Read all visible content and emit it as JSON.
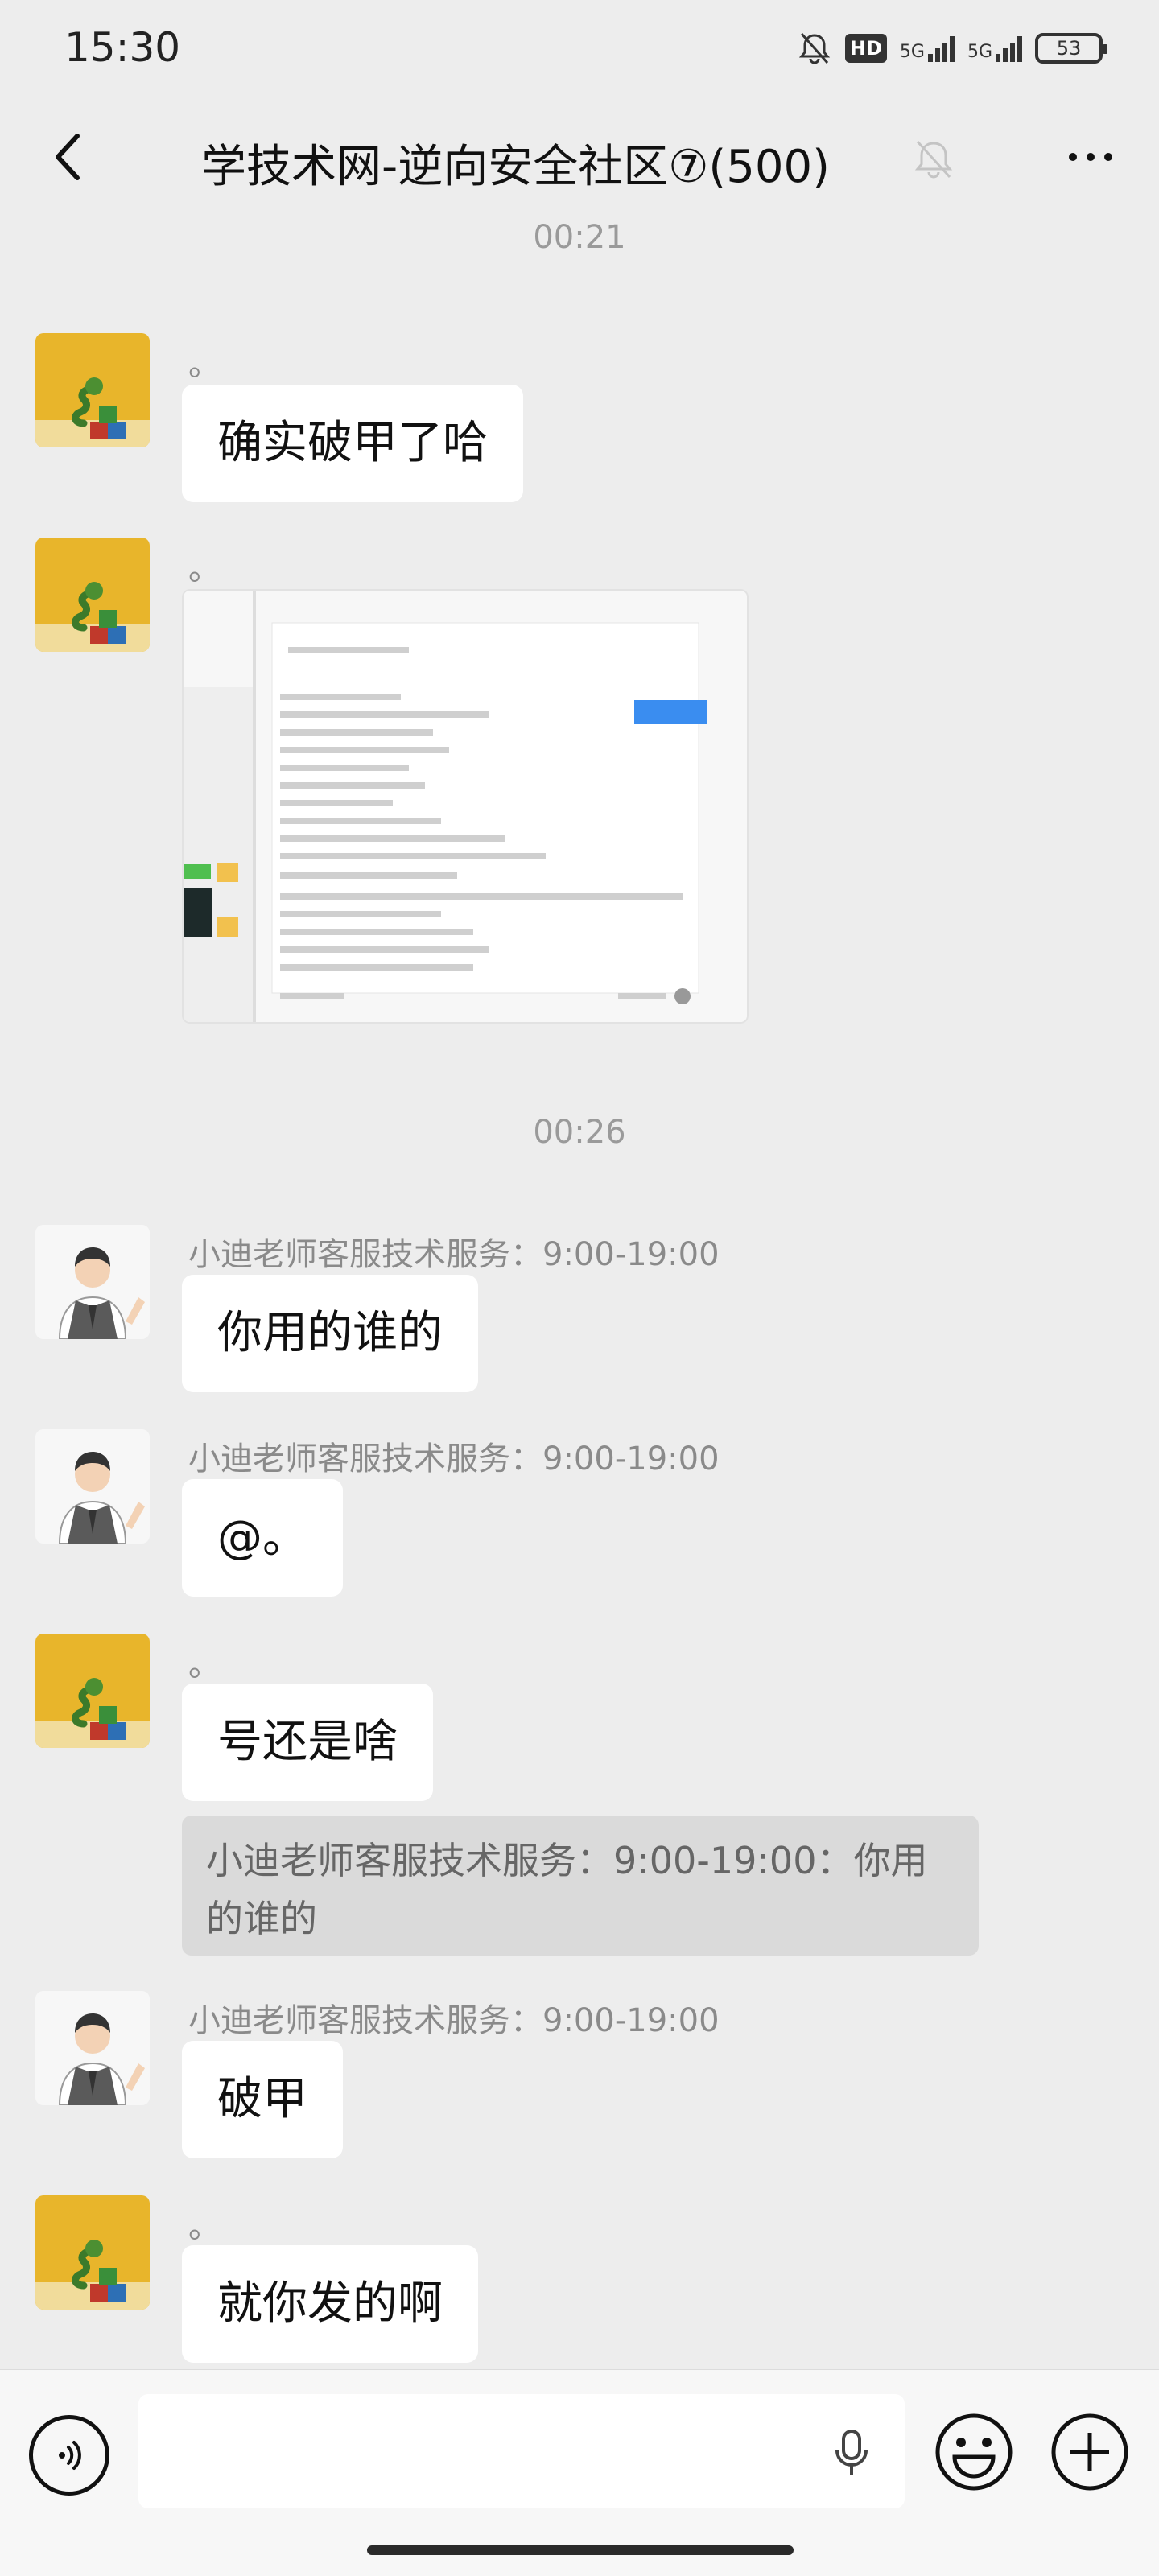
{
  "status_bar": {
    "time": "15:30",
    "hd_label": "HD",
    "network1": "5G",
    "network2": "5G",
    "battery": "53"
  },
  "header": {
    "title": "学技术网-逆向安全社区⑦(500)"
  },
  "messages": [
    {
      "type": "time",
      "text": "00:21"
    },
    {
      "type": "text",
      "sender": "。",
      "avatar": "snake",
      "text": "确实破甲了哈"
    },
    {
      "type": "image",
      "sender": "。",
      "avatar": "snake"
    },
    {
      "type": "time",
      "text": "00:26"
    },
    {
      "type": "text",
      "sender": "小迪老师客服技术服务：9:00-19:00",
      "avatar": "man",
      "text": "你用的谁的"
    },
    {
      "type": "text",
      "sender": "小迪老师客服技术服务：9:00-19:00",
      "avatar": "man",
      "text": "@。"
    },
    {
      "type": "text",
      "sender": "。",
      "avatar": "snake",
      "text": "号还是啥",
      "quote": "小迪老师客服技术服务：9:00-19:00：你用的谁的"
    },
    {
      "type": "text",
      "sender": "小迪老师客服技术服务：9:00-19:00",
      "avatar": "man",
      "text": "破甲"
    },
    {
      "type": "text",
      "sender": "。",
      "avatar": "snake",
      "text": "就你发的啊"
    }
  ],
  "input": {
    "value": "",
    "placeholder": ""
  },
  "colors": {
    "background": "#ededed",
    "bubble": "#ffffff",
    "quote": "#dadada",
    "snake_avatar": "#e8b52b"
  }
}
